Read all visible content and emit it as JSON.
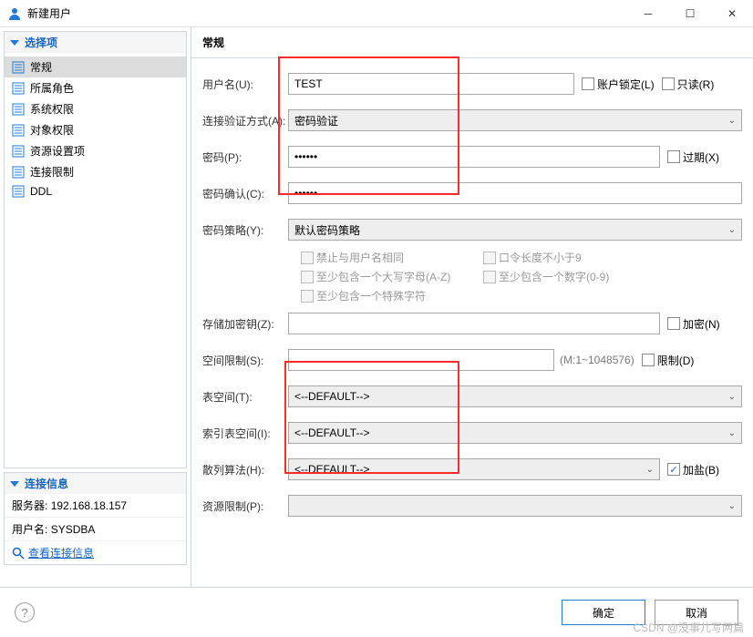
{
  "window": {
    "title": "新建用户"
  },
  "sidebar": {
    "options_header": "选择项",
    "items": [
      {
        "label": "常规",
        "selected": true
      },
      {
        "label": "所属角色",
        "selected": false
      },
      {
        "label": "系统权限",
        "selected": false
      },
      {
        "label": "对象权限",
        "selected": false
      },
      {
        "label": "资源设置项",
        "selected": false
      },
      {
        "label": "连接限制",
        "selected": false
      },
      {
        "label": "DDL",
        "selected": false
      }
    ],
    "conn_header": "连接信息",
    "server_label": "服务器:",
    "server_value": "192.168.18.157",
    "user_label": "用户名:",
    "user_value": "SYSDBA",
    "view_conn": "查看连接信息"
  },
  "main": {
    "title": "常规",
    "username_label": "用户名(U):",
    "username_value": "TEST",
    "lock_label": "账户锁定(L)",
    "readonly_label": "只读(R)",
    "auth_label": "连接验证方式(A):",
    "auth_value": "密码验证",
    "pwd_label": "密码(P):",
    "pwd_value": "••••••",
    "expire_label": "过期(X)",
    "pwd2_label": "密码确认(C):",
    "pwd2_value": "••••••",
    "policy_label": "密码策略(Y):",
    "policy_value": "默认密码策略",
    "policy_checks": {
      "r1c1": "禁止与用户名相同",
      "r1c2": "口令长度不小于9",
      "r2c1": "至少包含一个大写字母(A-Z)",
      "r2c2": "至少包含一个数字(0-9)",
      "r3c1": "至少包含一个特殊字符"
    },
    "encrypt_key_label": "存储加密钥(Z):",
    "encrypt_label": "加密(N)",
    "space_limit_label": "空间限制(S):",
    "space_hint": "(M:1~1048576)",
    "limit_label": "限制(D)",
    "tablespace_label": "表空间(T):",
    "tablespace_value": "<--DEFAULT-->",
    "index_ts_label": "索引表空间(I):",
    "index_ts_value": "<--DEFAULT-->",
    "hash_label": "散列算法(H):",
    "hash_value": "<--DEFAULT-->",
    "salt_label": "加盐(B)",
    "resource_label": "资源限制(P):"
  },
  "footer": {
    "ok": "确定",
    "cancel": "取消"
  },
  "watermark": "CSDN @没事儿写两篇"
}
